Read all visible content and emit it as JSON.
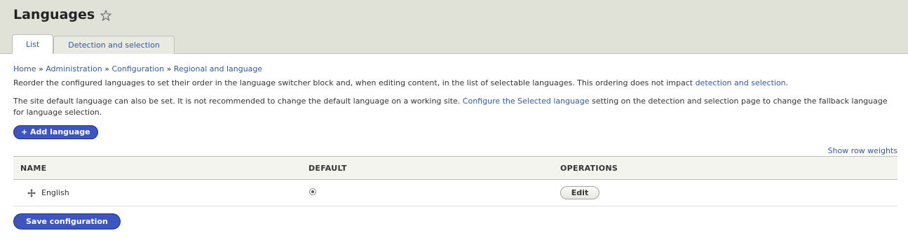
{
  "header": {
    "title": "Languages"
  },
  "tabs": [
    {
      "label": "List"
    },
    {
      "label": "Detection and selection"
    }
  ],
  "breadcrumb": {
    "items": [
      "Home",
      "Administration",
      "Configuration",
      "Regional and language"
    ],
    "separator": "»"
  },
  "description": {
    "p1_text": "Reorder the configured languages to set their order in the language switcher block and, when editing content, in the list of selectable languages. This ordering does not impact",
    "p1_link": "detection and selection",
    "p1_end": ".",
    "p2_text": "The site default language can also be set. It is not recommended to change the default language on a working site.",
    "p2_link": "Configure the Selected language",
    "p2_end": "setting on the detection and selection page to change the fallback language for language selection."
  },
  "actions": {
    "add_language": "+ Add language",
    "show_row_weights": "Show row weights",
    "save_configuration": "Save configuration"
  },
  "table": {
    "headers": [
      "NAME",
      "DEFAULT",
      "OPERATIONS"
    ],
    "rows": [
      {
        "name": "English",
        "default": true,
        "operation": "Edit"
      }
    ]
  },
  "colors": {
    "header_bg": "#e0e2d8",
    "link": "#3457a8",
    "primary_button": "#3c55c0"
  }
}
